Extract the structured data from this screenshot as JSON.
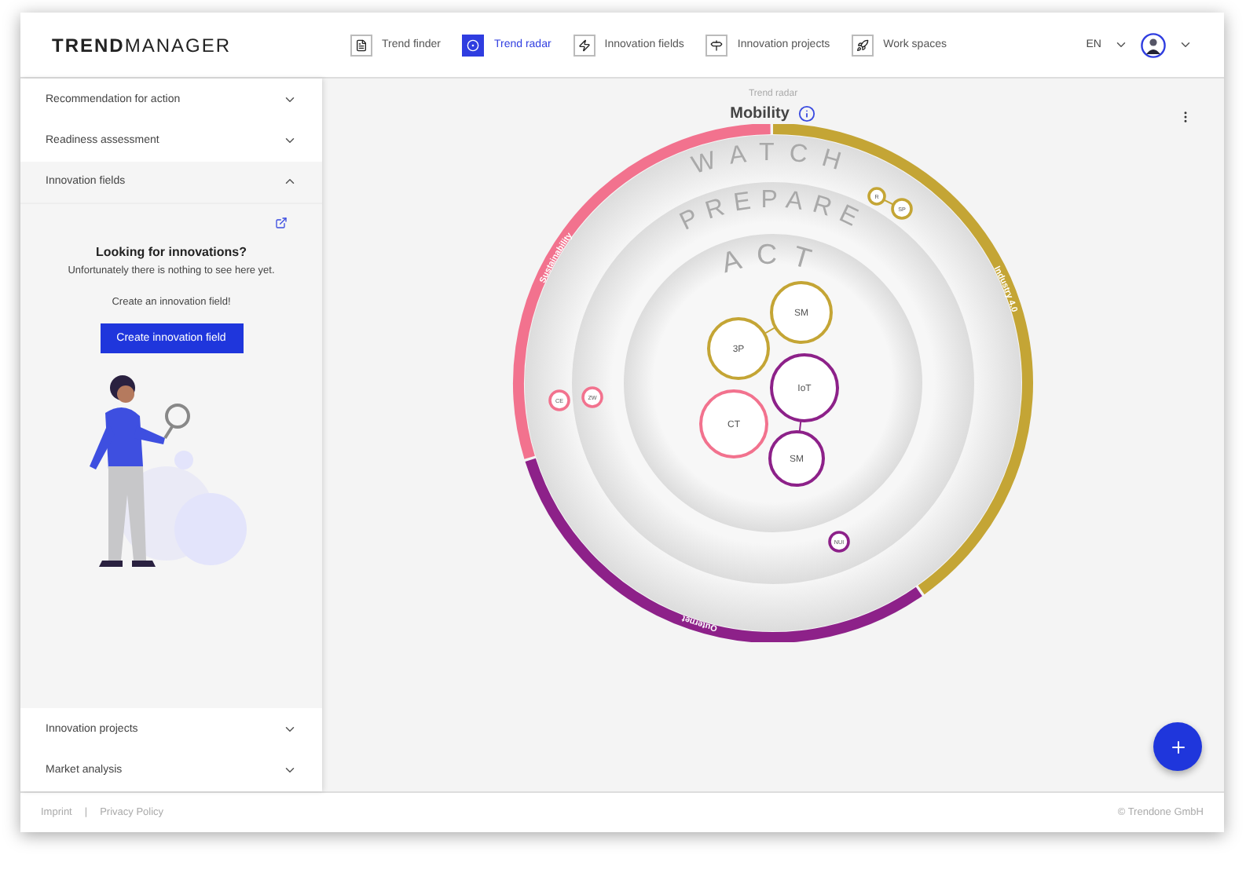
{
  "header": {
    "logo": "**TREND**MANAGER",
    "nav": [
      {
        "label": "Trend finder",
        "selected": false
      },
      {
        "label": "Trend radar",
        "selected": true
      },
      {
        "label": "Innovation fields",
        "selected": false
      },
      {
        "label": "Innovation projects",
        "selected": false
      },
      {
        "label": "Work spaces",
        "selected": false
      }
    ],
    "language": "EN"
  },
  "sidebar": {
    "sections": [
      {
        "label": "Recommendation for action",
        "expanded": false
      },
      {
        "label": "Readiness assessment",
        "expanded": false
      },
      {
        "label": "Innovation fields",
        "expanded": true
      },
      {
        "label": "Innovation projects",
        "expanded": false
      },
      {
        "label": "Market analysis",
        "expanded": false
      }
    ],
    "empty_state": {
      "heading": "Looking for innovations?",
      "message": "Unfortunately there is nothing to see here yet.",
      "prompt": "Create an innovation field!",
      "button": "Create innovation field"
    }
  },
  "radar": {
    "caption": "Trend radar",
    "title": "Mobility",
    "rings": [
      "WATCH",
      "PREPARE",
      "ACT"
    ],
    "sectors": [
      {
        "label": "Industry 4.0",
        "color": "#c4a535"
      },
      {
        "label": "Outernet",
        "color": "#8d2189"
      },
      {
        "label": "Sustainability",
        "color": "#f2728e"
      }
    ],
    "blips": [
      {
        "label": "R",
        "color": "#c4a535"
      },
      {
        "label": "SP",
        "color": "#c4a535"
      },
      {
        "label": "SM",
        "color": "#c4a535"
      },
      {
        "label": "3P",
        "color": "#c4a535"
      },
      {
        "label": "IoT",
        "color": "#8d2189"
      },
      {
        "label": "CT",
        "color": "#f2728e"
      },
      {
        "label": "SM",
        "color": "#8d2189"
      },
      {
        "label": "CE",
        "color": "#f2728e"
      },
      {
        "label": "ZW",
        "color": "#f2728e"
      },
      {
        "label": "NUI",
        "color": "#8d2189"
      }
    ]
  },
  "footer": {
    "links": [
      "Imprint",
      "Privacy Policy"
    ],
    "separator": "|",
    "copyright": "© Trendone GmbH"
  }
}
